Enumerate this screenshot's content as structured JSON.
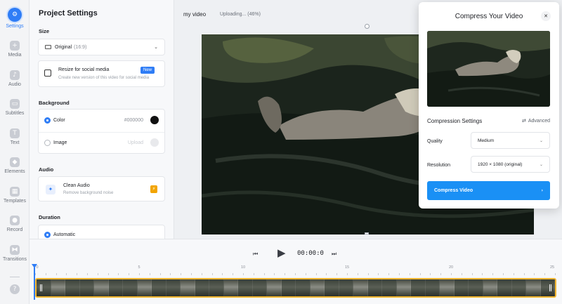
{
  "sidebar": {
    "items": [
      {
        "label": "Settings",
        "icon": "gear-icon",
        "glyph": "⚙",
        "active": true
      },
      {
        "label": "Media",
        "icon": "plus-icon",
        "glyph": "+"
      },
      {
        "label": "Audio",
        "icon": "music-note-icon",
        "glyph": "♪"
      },
      {
        "label": "Subtitles",
        "icon": "subtitles-icon",
        "glyph": "▭"
      },
      {
        "label": "Text",
        "icon": "text-icon",
        "glyph": "T"
      },
      {
        "label": "Elements",
        "icon": "elements-icon",
        "glyph": "◆"
      },
      {
        "label": "Templates",
        "icon": "templates-icon",
        "glyph": "▦"
      },
      {
        "label": "Record",
        "icon": "record-icon",
        "glyph": "●"
      },
      {
        "label": "Transitions",
        "icon": "transitions-icon",
        "glyph": "⧓"
      }
    ],
    "help_glyph": "?"
  },
  "settings": {
    "title": "Project Settings",
    "size": {
      "label": "Size",
      "value": "Original",
      "ratio": "(16:9)"
    },
    "resize": {
      "title": "Resize for social media",
      "subtitle": "Create new version of this video for social media",
      "badge": "New"
    },
    "background": {
      "label": "Background",
      "color_label": "Color",
      "color_value": "#000000",
      "image_label": "Image",
      "image_value": "Upload"
    },
    "audio": {
      "label": "Audio",
      "title": "Clean Audio",
      "subtitle": "Remove background noise"
    },
    "duration": {
      "label": "Duration",
      "option": "Automatic"
    }
  },
  "header": {
    "project_name": "my video",
    "upload_status": "Uploading... (46%)",
    "upload_progress": 46
  },
  "modal": {
    "title": "Compress Your Video",
    "close_glyph": "✕",
    "settings_title": "Compression Settings",
    "advanced_label": "Advanced",
    "advanced_glyph": "⇄",
    "quality": {
      "label": "Quality",
      "value": "Medium"
    },
    "resolution": {
      "label": "Resolution",
      "value": "1920 × 1080 (original)"
    },
    "button_label": "Compress Video",
    "button_glyph": "›"
  },
  "transport": {
    "rewind_glyph": "⏮",
    "play_glyph": "▶",
    "forward_glyph": "⏭",
    "timecode": "00:00:0"
  },
  "timeline": {
    "ruler_labels": [
      "0",
      "5",
      "10",
      "15",
      "20",
      "25"
    ],
    "ruler_max": 25
  },
  "colors": {
    "accent": "#2f7df6",
    "compress_button": "#1a90f5",
    "track_border": "#f2b630",
    "new_badge": "#2f7df6",
    "bolt_badge": "#f2a400"
  }
}
